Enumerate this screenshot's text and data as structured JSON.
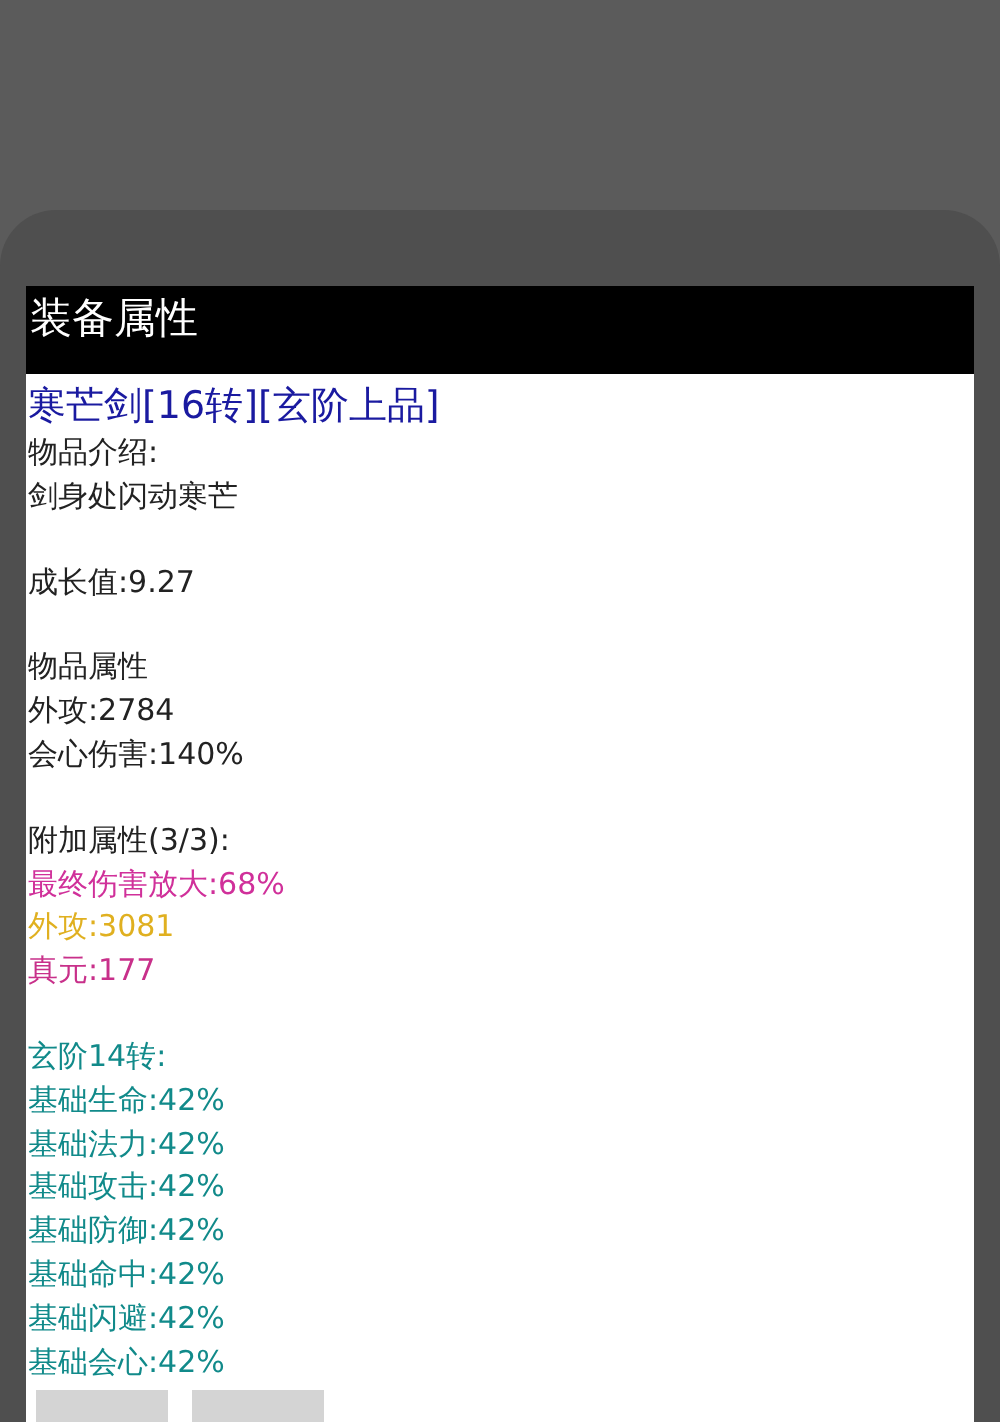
{
  "dialog": {
    "title": "装备属性",
    "item_name": "寒芒剑[16转][玄阶上品]",
    "sections": [
      {
        "lines": [
          {
            "text": "物品介绍:",
            "color": "#222222"
          },
          {
            "text": "剑身处闪动寒芒",
            "color": "#222222"
          }
        ]
      },
      {
        "lines": [
          {
            "text": "成长值:9.27",
            "color": "#222222"
          }
        ]
      },
      {
        "lines": [
          {
            "text": "物品属性",
            "color": "#222222"
          },
          {
            "text": "外攻:2784",
            "color": "#222222"
          },
          {
            "text": "会心伤害:140%",
            "color": "#222222"
          }
        ]
      },
      {
        "lines": [
          {
            "text": "附加属性(3/3):",
            "color": "#222222"
          },
          {
            "text": "最终伤害放大:68%",
            "color": "#d0309a"
          },
          {
            "text": "外攻:3081",
            "color": "#e0b020"
          },
          {
            "text": "真元:177",
            "color": "#c8308a"
          }
        ]
      },
      {
        "lines": [
          {
            "text": "玄阶14转:",
            "color": "#118a8a"
          },
          {
            "text": "基础生命:42%",
            "color": "#118a8a"
          },
          {
            "text": "基础法力:42%",
            "color": "#118a8a"
          },
          {
            "text": "基础攻击:42%",
            "color": "#118a8a"
          },
          {
            "text": "基础防御:42%",
            "color": "#118a8a"
          },
          {
            "text": "基础命中:42%",
            "color": "#118a8a"
          },
          {
            "text": "基础闪避:42%",
            "color": "#118a8a"
          },
          {
            "text": "基础会心:42%",
            "color": "#118a8a"
          }
        ]
      }
    ],
    "buttons": [
      {
        "kind": "blank"
      },
      {
        "kind": "blank"
      }
    ]
  }
}
